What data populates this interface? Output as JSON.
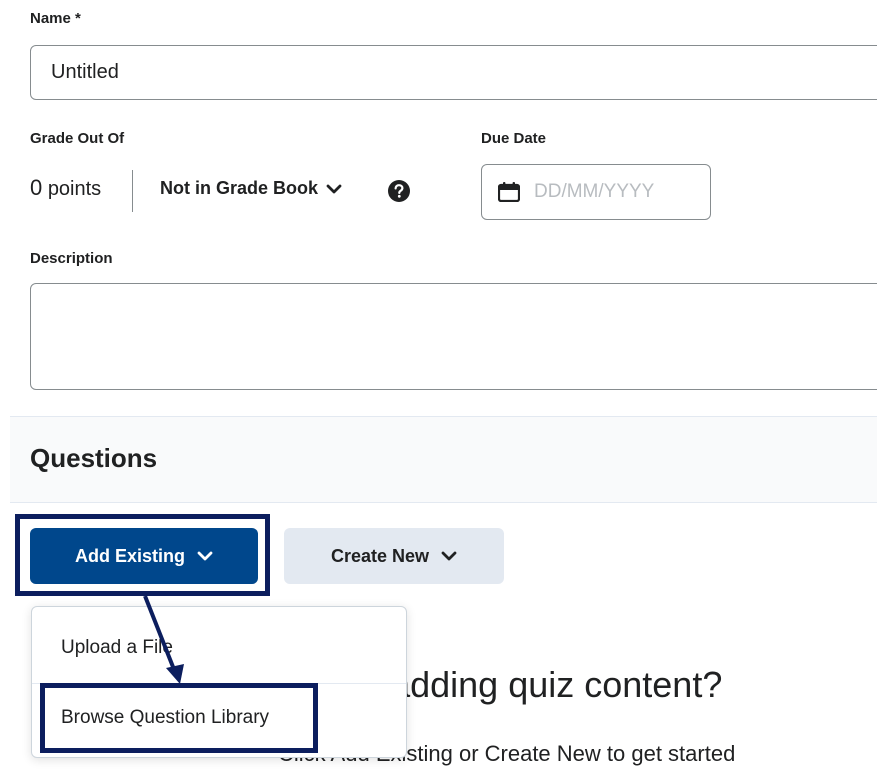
{
  "form": {
    "name_label": "Name *",
    "name_value": "Untitled",
    "grade_label": "Grade Out Of",
    "points_value": "0",
    "points_unit": "points",
    "gradebook_status": "Not in Grade Book",
    "due_date_label": "Due Date",
    "due_date_placeholder": "DD/MM/YYYY",
    "description_label": "Description"
  },
  "questions": {
    "title": "Questions",
    "add_existing_label": "Add Existing",
    "create_new_label": "Create New"
  },
  "dropdown": {
    "items": [
      {
        "label": "Upload a File"
      },
      {
        "label": "Browse Question Library"
      }
    ]
  },
  "empty_state": {
    "heading": "begin adding quiz content?",
    "subtext": "Click Add Existing or Create New to get started"
  },
  "colors": {
    "primary": "#00478c",
    "highlight": "#0c1e5e",
    "secondary_button": "#e3e9f1"
  },
  "icons": [
    "calendar-icon",
    "help-icon",
    "chevron-down-icon"
  ]
}
